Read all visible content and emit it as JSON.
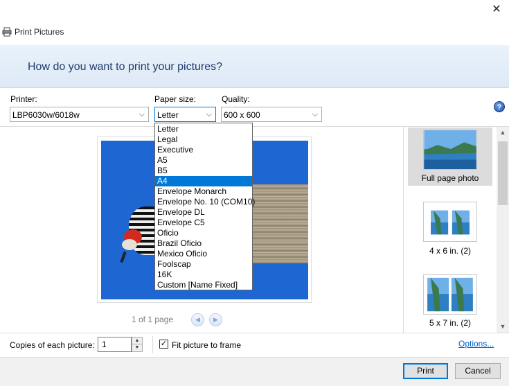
{
  "window": {
    "close_glyph": "✕"
  },
  "dialog": {
    "title": "Print Pictures",
    "question": "How do you want to print your pictures?"
  },
  "printer": {
    "label": "Printer:",
    "value": "LBP6030w/6018w"
  },
  "paper_size": {
    "label": "Paper size:",
    "value": "Letter",
    "options": [
      "Letter",
      "Legal",
      "Executive",
      "A5",
      "B5",
      "A4",
      "Envelope Monarch",
      "Envelope No. 10 (COM10)",
      "Envelope DL",
      "Envelope C5",
      "Oficio",
      "Brazil Oficio",
      "Mexico Oficio",
      "Foolscap",
      "16K",
      "Custom [Name Fixed]"
    ],
    "highlighted": "A4"
  },
  "quality": {
    "label": "Quality:",
    "value": "600 x 600"
  },
  "help": {
    "glyph": "?"
  },
  "pager": {
    "text": "1 of 1 page",
    "prev_glyph": "◀",
    "next_glyph": "▶"
  },
  "layouts": [
    {
      "label": "Full page photo",
      "selected": true
    },
    {
      "label": "4 x 6 in. (2)",
      "selected": false
    },
    {
      "label": "5 x 7 in. (2)",
      "selected": false
    }
  ],
  "copies": {
    "label": "Copies of each picture:",
    "value": "1"
  },
  "fit": {
    "label": "Fit picture to frame",
    "checked": true,
    "check_glyph": "✓"
  },
  "options_link": "Options...",
  "buttons": {
    "print": "Print",
    "cancel": "Cancel"
  },
  "colors": {
    "accent": "#0078d7",
    "banner_text": "#1e3b6a",
    "link": "#0066cc"
  }
}
